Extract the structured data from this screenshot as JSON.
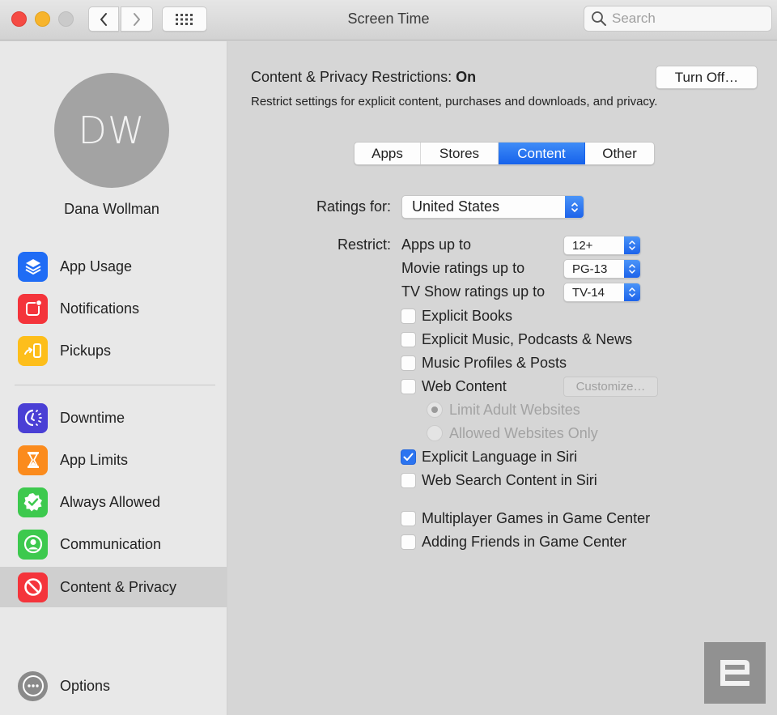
{
  "window": {
    "title": "Screen Time",
    "search_placeholder": "Search"
  },
  "sidebar": {
    "avatar_initials": "DW",
    "user_name": "Dana Wollman",
    "items": [
      {
        "label": "App Usage",
        "icon": "layers-icon",
        "color": "#1f6cf5"
      },
      {
        "label": "Notifications",
        "icon": "notification-badge-icon",
        "color": "#f4343b"
      },
      {
        "label": "Pickups",
        "icon": "pickup-phone-icon",
        "color": "#fdbe1b"
      },
      {
        "label": "Downtime",
        "icon": "downtime-clock-icon",
        "color": "#4a3fd5"
      },
      {
        "label": "App Limits",
        "icon": "hourglass-icon",
        "color": "#fb8b1d"
      },
      {
        "label": "Always Allowed",
        "icon": "checkmark-seal-icon",
        "color": "#3dc94e"
      },
      {
        "label": "Communication",
        "icon": "person-circle-icon",
        "color": "#3dc94e"
      },
      {
        "label": "Content & Privacy",
        "icon": "prohibited-icon",
        "color": "#f4343b",
        "selected": true
      }
    ],
    "options_label": "Options"
  },
  "main": {
    "status_prefix": "Content & Privacy Restrictions:",
    "status_value": "On",
    "description": "Restrict settings for explicit content, purchases and downloads, and privacy.",
    "turn_off_label": "Turn Off…",
    "tabs": [
      {
        "label": "Apps",
        "active": false
      },
      {
        "label": "Stores",
        "active": false
      },
      {
        "label": "Content",
        "active": true
      },
      {
        "label": "Other",
        "active": false
      }
    ],
    "ratings_for_label": "Ratings for:",
    "ratings_for_value": "United States",
    "restrict_label": "Restrict:",
    "restrict_rows": [
      {
        "label": "Apps up to",
        "value": "12+"
      },
      {
        "label": "Movie ratings up to",
        "value": "PG-13"
      },
      {
        "label": "TV Show ratings up to",
        "value": "TV-14"
      }
    ],
    "checkboxes": [
      {
        "label": "Explicit Books",
        "checked": false
      },
      {
        "label": "Explicit Music, Podcasts & News",
        "checked": false
      },
      {
        "label": "Music Profiles & Posts",
        "checked": false
      },
      {
        "label": "Web Content",
        "checked": false
      }
    ],
    "customize_label": "Customize…",
    "web_radios": [
      {
        "label": "Limit Adult Websites",
        "selected": true,
        "disabled": true
      },
      {
        "label": "Allowed Websites Only",
        "selected": false,
        "disabled": true
      }
    ],
    "siri_checkboxes": [
      {
        "label": "Explicit Language in Siri",
        "checked": true
      },
      {
        "label": "Web Search Content in Siri",
        "checked": false
      }
    ],
    "game_center_checkboxes": [
      {
        "label": "Multiplayer Games in Game Center",
        "checked": false
      },
      {
        "label": "Adding Friends in Game Center",
        "checked": false
      }
    ]
  },
  "accent_color": "#1662eb"
}
